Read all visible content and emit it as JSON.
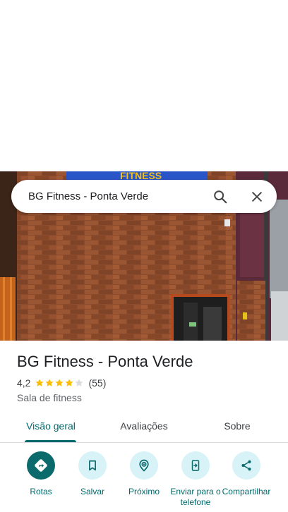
{
  "search": {
    "query": "BG Fitness - Ponta Verde"
  },
  "place": {
    "name": "BG Fitness - Ponta Verde",
    "rating": "4,2",
    "stars_filled": 4,
    "stars_total": 5,
    "review_count": "(55)",
    "category": "Sala de fitness"
  },
  "hero": {
    "sign_text": "FITNESS"
  },
  "tabs": [
    {
      "label": "Visão geral",
      "active": true
    },
    {
      "label": "Avaliações",
      "active": false
    },
    {
      "label": "Sobre",
      "active": false
    }
  ],
  "actions": [
    {
      "label": "Rotas",
      "icon": "directions-icon"
    },
    {
      "label": "Salvar",
      "icon": "bookmark-icon"
    },
    {
      "label": "Próximo",
      "icon": "nearby-icon"
    },
    {
      "label": "Enviar para o telefone",
      "icon": "send-to-phone-icon"
    },
    {
      "label": "Compartilhar",
      "icon": "share-icon"
    }
  ],
  "colors": {
    "accent": "#00696b",
    "action_bg": "#d7f3f7",
    "primary_action_bg": "#0b6a6b",
    "star": "#fbbc04",
    "star_empty": "#dadce0"
  }
}
